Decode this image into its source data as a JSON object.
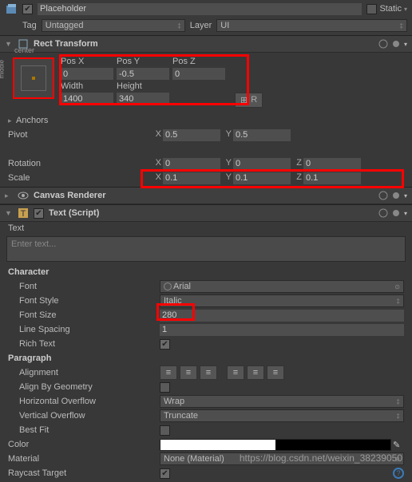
{
  "header": {
    "name": "Placeholder",
    "static": "Static",
    "tag_label": "Tag",
    "tag_value": "Untagged",
    "layer_label": "Layer",
    "layer_value": "UI"
  },
  "rect": {
    "title": "Rect Transform",
    "anchor_top": "center",
    "anchor_side": "middle",
    "posx_label": "Pos X",
    "posx": "0",
    "posy_label": "Pos Y",
    "posy": "-0.5",
    "posz_label": "Pos Z",
    "posz": "0",
    "width_label": "Width",
    "width": "1400",
    "height_label": "Height",
    "height": "340",
    "r_btn": "R",
    "anchors": "Anchors",
    "pivot": "Pivot",
    "pivot_x": "0.5",
    "pivot_y": "0.5",
    "rotation": "Rotation",
    "rot_x": "0",
    "rot_y": "0",
    "rot_z": "0",
    "scale": "Scale",
    "scale_x": "0.1",
    "scale_y": "0.1",
    "scale_z": "0.1"
  },
  "canvas": {
    "title": "Canvas Renderer"
  },
  "text": {
    "title": "Text (Script)",
    "text_label": "Text",
    "placeholder": "Enter text...",
    "character": "Character",
    "font_label": "Font",
    "font": "Arial",
    "fontstyle_label": "Font Style",
    "fontstyle": "Italic",
    "fontsize_label": "Font Size",
    "fontsize": "280",
    "linespacing_label": "Line Spacing",
    "linespacing": "1",
    "richtext_label": "Rich Text",
    "paragraph": "Paragraph",
    "alignment": "Alignment",
    "alignbygeom": "Align By Geometry",
    "hoverflow_label": "Horizontal Overflow",
    "hoverflow": "Wrap",
    "voverflow_label": "Vertical Overflow",
    "voverflow": "Truncate",
    "bestfit": "Best Fit",
    "color": "Color",
    "material_label": "Material",
    "material": "None (Material)",
    "raycast": "Raycast Target"
  },
  "axes": {
    "x": "X",
    "y": "Y",
    "z": "Z"
  }
}
